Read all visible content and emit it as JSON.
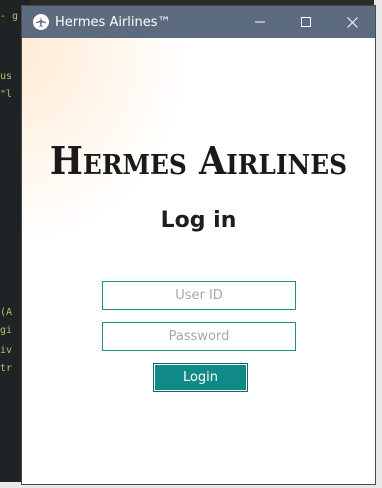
{
  "background_editor": {
    "lines": [
      "- g",
      "us",
      "\"l",
      "(A",
      "gi",
      "iv",
      "tr"
    ]
  },
  "window": {
    "title": "Hermes Airlines™",
    "icon": "airplane-icon",
    "controls": {
      "minimize": "minimize-icon",
      "maximize": "maximize-icon",
      "close": "close-icon"
    }
  },
  "login": {
    "brand": "Hermes Airlines",
    "heading": "Log in",
    "user_id_placeholder": "User ID",
    "password_placeholder": "Password",
    "login_label": "Login"
  },
  "colors": {
    "titlebar": "#5d6b80",
    "accent": "#0f8a86",
    "field_border": "#1b8e8a"
  }
}
